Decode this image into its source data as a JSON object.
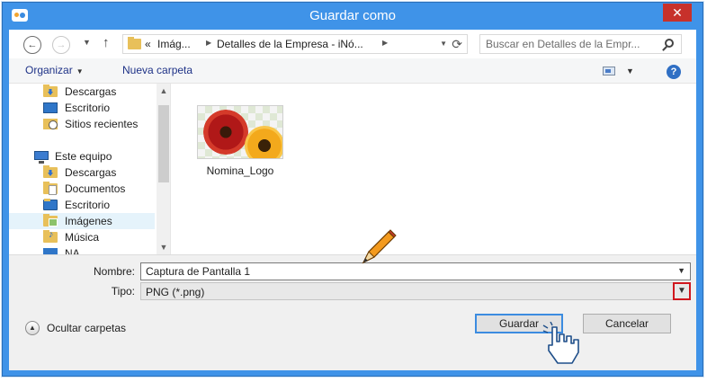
{
  "window": {
    "title": "Guardar como",
    "close_label": "✕"
  },
  "address": {
    "prefix": "«",
    "crumbs": [
      "Imág...",
      "Detalles de la Empresa - iNó..."
    ],
    "search_placeholder": "Buscar en Detalles de la Empr..."
  },
  "toolbar": {
    "organize_label": "Organizar",
    "new_folder_label": "Nueva carpeta",
    "help_label": "?"
  },
  "sidebar": {
    "items": [
      {
        "label": "Descargas",
        "icon": "downloads-icon"
      },
      {
        "label": "Escritorio",
        "icon": "desktop-icon"
      },
      {
        "label": "Sitios recientes",
        "icon": "recent-places-icon"
      },
      {
        "label": "Este equipo",
        "icon": "computer-icon"
      },
      {
        "label": "Descargas",
        "icon": "downloads-icon"
      },
      {
        "label": "Documentos",
        "icon": "documents-icon"
      },
      {
        "label": "Escritorio",
        "icon": "desktop-icon"
      },
      {
        "label": "Imágenes",
        "icon": "pictures-icon",
        "selected": true
      },
      {
        "label": "Música",
        "icon": "music-icon"
      },
      {
        "label": "NA...",
        "icon": "network-icon"
      }
    ]
  },
  "files": [
    {
      "name": "Nomina_Logo",
      "icon": "image-thumbnail-icon"
    }
  ],
  "form": {
    "name_label": "Nombre:",
    "name_value": "Captura de Pantalla 1",
    "type_label": "Tipo:",
    "type_value": "PNG (*.png)",
    "hide_folders_label": "Ocultar carpetas",
    "save_label": "Guardar",
    "cancel_label": "Cancelar"
  },
  "colors": {
    "title_bar": "#3f93e8",
    "close_button": "#c7312b",
    "highlight_box": "#d0171e",
    "default_button_border": "#3c8ce0"
  }
}
